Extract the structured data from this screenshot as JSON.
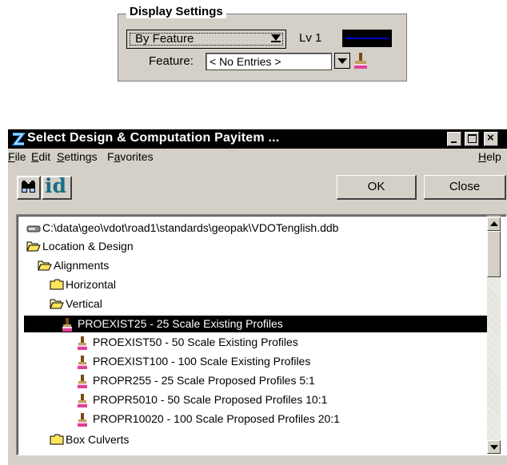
{
  "display_settings": {
    "title": "Display Settings",
    "mode_value": "By Feature",
    "level_label": "Lv 1",
    "swatch_color": "#0000cc",
    "feature_label": "Feature:",
    "feature_value": "< No Entries >"
  },
  "window": {
    "title": "Select Design & Computation Payitem ...",
    "menu": {
      "file": "File",
      "edit": "Edit",
      "settings": "Settings",
      "favorites": "Favorites",
      "help": "Help"
    },
    "toolbar": {
      "find_icon": "binoculars-icon",
      "id_label": "id",
      "ok_label": "OK",
      "close_label": "Close"
    },
    "tree": [
      {
        "icon": "database-icon",
        "label": "C:\\data\\geo\\vdot\\road1\\standards\\geopak\\VDOTenglish.ddb"
      },
      {
        "icon": "folder-open-icon",
        "label": "Location & Design"
      },
      {
        "icon": "folder-open-icon",
        "label": "Alignments"
      },
      {
        "icon": "folder-closed-icon",
        "label": "Horizontal"
      },
      {
        "icon": "folder-open-icon",
        "label": "Vertical"
      },
      {
        "icon": "paint-brush-icon",
        "label": "PROEXIST25 - 25 Scale Existing Profiles",
        "selected": true
      },
      {
        "icon": "paint-brush-icon",
        "label": "PROEXIST50 - 50 Scale Existing Profiles"
      },
      {
        "icon": "paint-brush-icon",
        "label": "PROEXIST100 - 100 Scale Existing Profiles"
      },
      {
        "icon": "paint-brush-icon",
        "label": "PROPR255 - 25 Scale Proposed Profiles 5:1"
      },
      {
        "icon": "paint-brush-icon",
        "label": "PROPR5010 - 50 Scale Proposed Profiles 10:1"
      },
      {
        "icon": "paint-brush-icon",
        "label": "PROPR10020 - 100 Scale Proposed Profiles 20:1"
      },
      {
        "icon": "folder-closed-icon",
        "label": "Box Culverts"
      }
    ]
  }
}
